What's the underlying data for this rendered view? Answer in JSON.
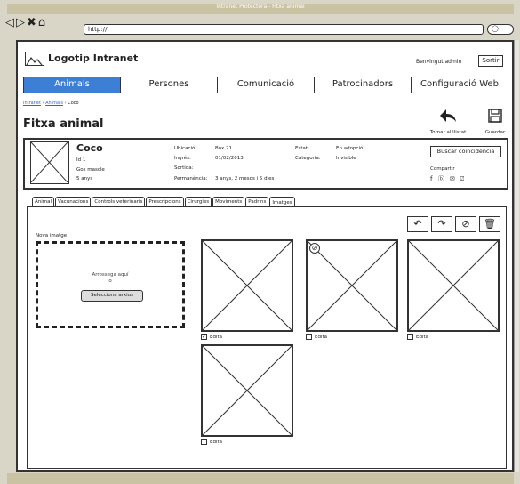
{
  "window": {
    "title": "Intranet Protectora - Fitxa animal",
    "url": "http://"
  },
  "browser": {
    "nav_glyphs": "◁▷✖⌂",
    "search_glyph": "◯"
  },
  "header": {
    "logo_text": "Logotip Intranet",
    "welcome": "Benvingut admin",
    "logout_label": "Sortir"
  },
  "menu": [
    {
      "label": "Animals",
      "active": true
    },
    {
      "label": "Persones"
    },
    {
      "label": "Comunicació"
    },
    {
      "label": "Patrocinadors"
    },
    {
      "label": "Configuració Web"
    }
  ],
  "breadcrumb": {
    "items": [
      "Intranet",
      "Animals"
    ],
    "current": "Coco",
    "sep": " › "
  },
  "page": {
    "title": "Fitxa animal"
  },
  "toolbar": {
    "back_label": "Tornar al llistat",
    "save_label": "Guardar",
    "back_icon": "back-arrow",
    "save_icon": "floppy"
  },
  "record": {
    "name": "Coco",
    "id": "Id 1",
    "type": "Gos mascle",
    "age": "5 anys",
    "fields": {
      "ubicacio_label": "Ubicació",
      "ubicacio": "Box 21",
      "ingres_label": "Ingrés:",
      "ingres": "01/02/2013",
      "sortida_label": "Sortida:",
      "sortida": "",
      "permanencia_label": "Permanència:",
      "permanencia": "3 anys, 2 mesos i 5 dies",
      "estat_label": "Estat:",
      "estat": "En adopció",
      "categoria_label": "Categoria:",
      "categoria": "Invisible"
    },
    "match_button": "Buscar coincidència",
    "share_label": "Compartir",
    "share_icons": "f ⓑ ✉ ⍁"
  },
  "tabs": [
    {
      "label": "Animal"
    },
    {
      "label": "Vacunacions"
    },
    {
      "label": "Controls veterinaris"
    },
    {
      "label": "Prescripcions"
    },
    {
      "label": "Cirurgies"
    },
    {
      "label": "Moviments"
    },
    {
      "label": "Padrins"
    },
    {
      "label": "Imatges",
      "active": true
    }
  ],
  "images": {
    "panel_tools": [
      "↶",
      "↷",
      "⊘",
      "🗑"
    ],
    "new_image_label": "Nova imatge",
    "drop_text_1": "Arrossega aquí",
    "drop_text_2": "o",
    "select_files": "Selecciona arxius",
    "edit_label": "Edita",
    "items": [
      {
        "checked": true,
        "badge": false
      },
      {
        "checked": false,
        "badge": true
      },
      {
        "checked": false,
        "badge": false
      },
      {
        "checked": false,
        "badge": false
      }
    ]
  }
}
